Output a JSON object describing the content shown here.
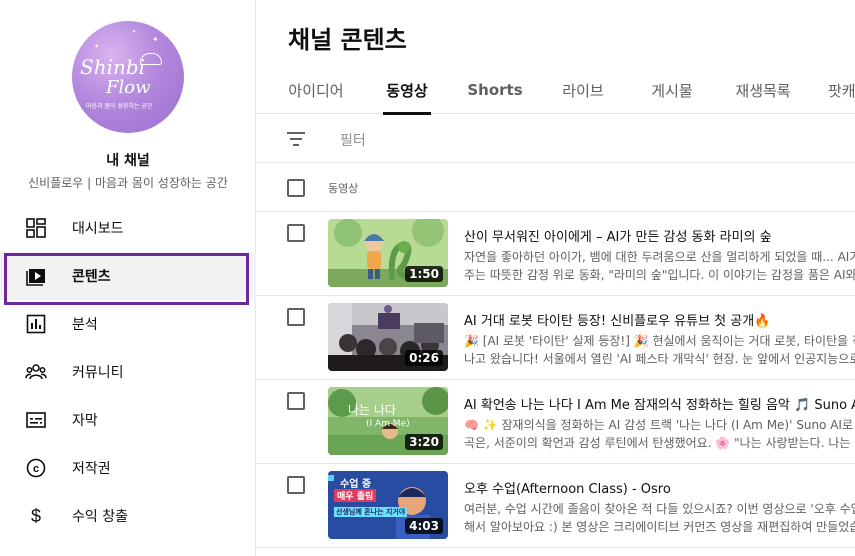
{
  "channel": {
    "logo_line1": "Shinbi",
    "logo_line2": "Flow",
    "logo_sub": "마음과 몸이 성장하는 공간",
    "name": "내 채널",
    "description": "신비플로우 | 마음과 몸이 성장하는 공간"
  },
  "nav": [
    {
      "label": "대시보드",
      "icon": "dashboard-icon"
    },
    {
      "label": "콘텐츠",
      "icon": "content-icon",
      "active": true
    },
    {
      "label": "분석",
      "icon": "analytics-icon"
    },
    {
      "label": "커뮤니티",
      "icon": "community-icon"
    },
    {
      "label": "자막",
      "icon": "subtitles-icon"
    },
    {
      "label": "저작권",
      "icon": "copyright-icon"
    },
    {
      "label": "수익 창출",
      "icon": "dollar-icon"
    }
  ],
  "page_title": "채널 콘텐츠",
  "tabs": [
    "아이디어",
    "동영상",
    "Shorts",
    "라이브",
    "게시물",
    "재생목록",
    "팟캐"
  ],
  "active_tab": "동영상",
  "filter_placeholder": "필터",
  "column_header": "동영상",
  "videos": [
    {
      "title": "산이 무서워진 아이에게 – AI가 만든 감성 동화 라미의 숲",
      "desc1": "자연을 좋아하던 아이가, 뱀에 대한 두려움으로 산을 멀리하게 되었을 때... AI가",
      "desc2": "주는 따뜻한 감정 위로 동화, \"라미의 숲\"입니다. 이 이야기는 감정을 품은 AI와, 아",
      "duration": "1:50"
    },
    {
      "title": "AI 거대 로봇 타이탄 등장! 신비플로우 유튜브 첫 공개🔥",
      "desc1": "🎉 [AI 로봇 '타이탄' 실제 등장!] 🎉 현실에서 움직이는 거대 로봇, 타이탄을 직",
      "desc2": "나고 왔습니다! 서울에서 열린 'AI 페스타 개막식' 현장. 눈 앞에서 인공지능으로",
      "duration": "0:26"
    },
    {
      "title": "AI 확언송 나는 나다 I Am Me 잠재의식 정화하는 힐링 음악 🎵 Suno AI 감",
      "desc1": "🧠 ✨ 잠재의식을 정화하는 AI 감성 트랙 '나는 나다 (I Am Me)' Suno AI로 만",
      "desc2": "곡은, 서준이의 확언과 감성 루틴에서 탄생했어요. 🌸 \"나는 사랑받는다. 나는 충",
      "duration": "3:20",
      "thumb_text1": "나는 나다",
      "thumb_text2": "(I Am Me)"
    },
    {
      "title": "오후 수업(Afternoon Class) - Osro",
      "desc1": "여러분, 수업 시간에 졸음이 찾아온 적 다들 있으시죠? 이번 영상으로 '오후 수업'",
      "desc2": "해서 알아보아요 :) 본 영상은 크리에이티브 커먼즈 영상을 재편집하여 만들었습니",
      "duration": "4:03",
      "thumb_text1": "수업 중",
      "thumb_text2": "매우 졸림",
      "thumb_text3": "선생님께 혼나는 지거야"
    }
  ],
  "colors": {
    "highlight": "#6a2a9c",
    "active_bg": "#f2f2f2",
    "avatar": "#b388dd"
  }
}
